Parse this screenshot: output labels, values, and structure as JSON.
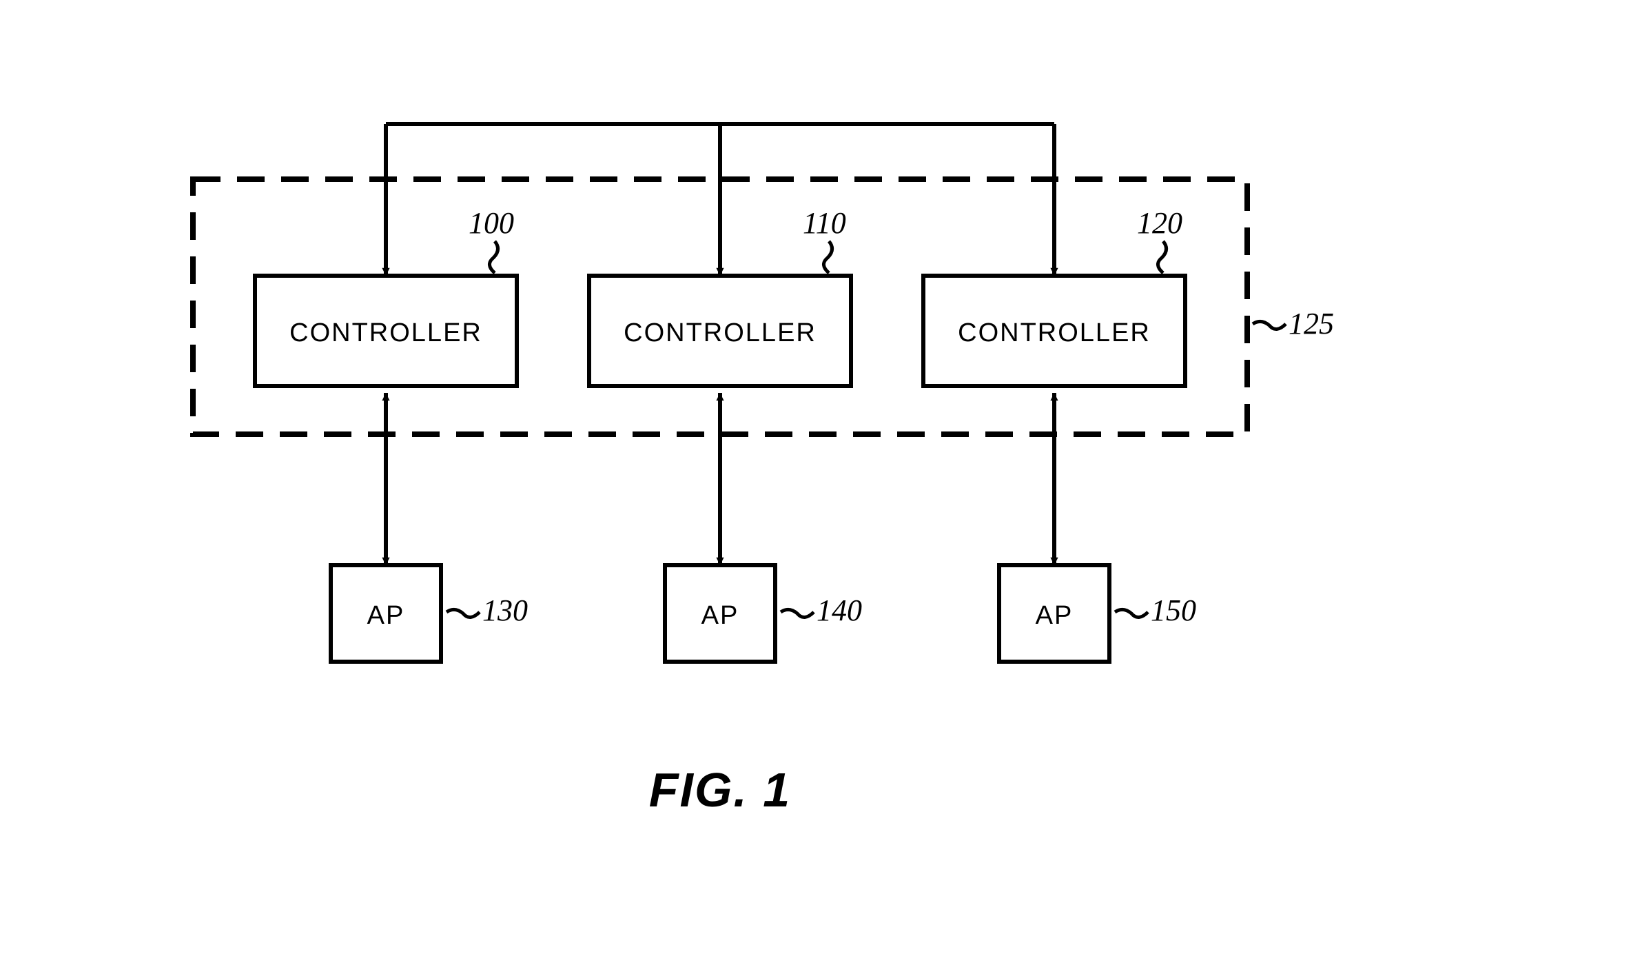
{
  "controllers": [
    {
      "text": "CONTROLLER",
      "ref": "100"
    },
    {
      "text": "CONTROLLER",
      "ref": "110"
    },
    {
      "text": "CONTROLLER",
      "ref": "120"
    }
  ],
  "aps": [
    {
      "text": "AP",
      "ref": "130"
    },
    {
      "text": "AP",
      "ref": "140"
    },
    {
      "text": "AP",
      "ref": "150"
    }
  ],
  "group_ref": "125",
  "figure_label": "FIG. 1"
}
